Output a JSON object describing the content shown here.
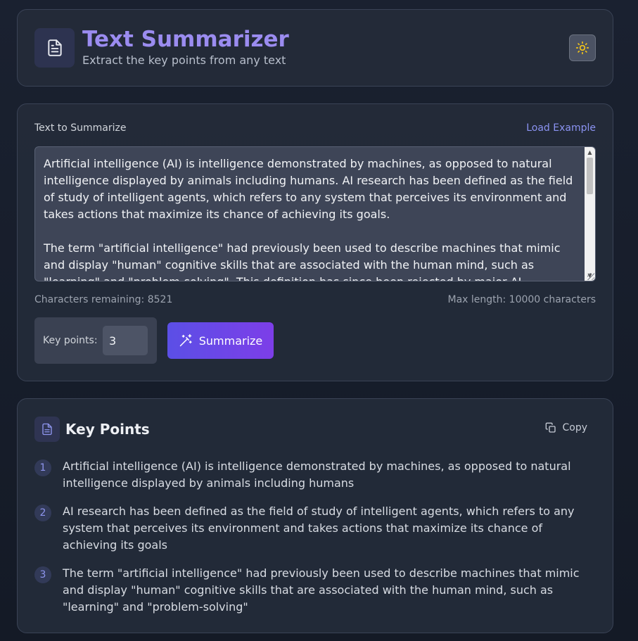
{
  "header": {
    "title": "Text Summarizer",
    "subtitle": "Extract the key points from any text",
    "logo_icon": "document-icon",
    "theme_icon": "sun-icon"
  },
  "input": {
    "label": "Text to Summarize",
    "load_example": "Load Example",
    "text": "Artificial intelligence (AI) is intelligence demonstrated by machines, as opposed to natural intelligence displayed by animals including humans. AI research has been defined as the field of study of intelligent agents, which refers to any system that perceives its environment and takes actions that maximize its chance of achieving its goals.\n\nThe term \"artificial intelligence\" had previously been used to describe machines that mimic and display \"human\" cognitive skills that are associated with the human mind, such as \"learning\" and \"problem-solving\". This definition has since been rejected by major AI",
    "chars_remaining": "Characters remaining: 8521",
    "max_length": "Max length: 10000 characters",
    "key_points_label": "Key points:",
    "key_points_value": "3",
    "summarize_label": "Summarize",
    "summarize_icon": "magic-wand-icon"
  },
  "results": {
    "title": "Key Points",
    "copy_label": "Copy",
    "copy_icon": "copy-icon",
    "points": [
      {
        "num": "1",
        "text": "Artificial intelligence (AI) is intelligence demonstrated by machines, as opposed to natural intelligence displayed by animals including humans"
      },
      {
        "num": "2",
        "text": "AI research has been defined as the field of study of intelligent agents, which refers to any system that perceives its environment and takes actions that maximize its chance of achieving its goals"
      },
      {
        "num": "3",
        "text": "The term \"artificial intelligence\" had previously been used to describe machines that mimic and display \"human\" cognitive skills that are associated with the human mind, such as \"learning\" and \"problem-solving\""
      }
    ]
  },
  "colors": {
    "accent": "#9b8cf0",
    "link": "#8b93f2",
    "button_gradient_start": "#5b4fe6",
    "button_gradient_end": "#7d3ee8",
    "sun": "#f5c518"
  }
}
